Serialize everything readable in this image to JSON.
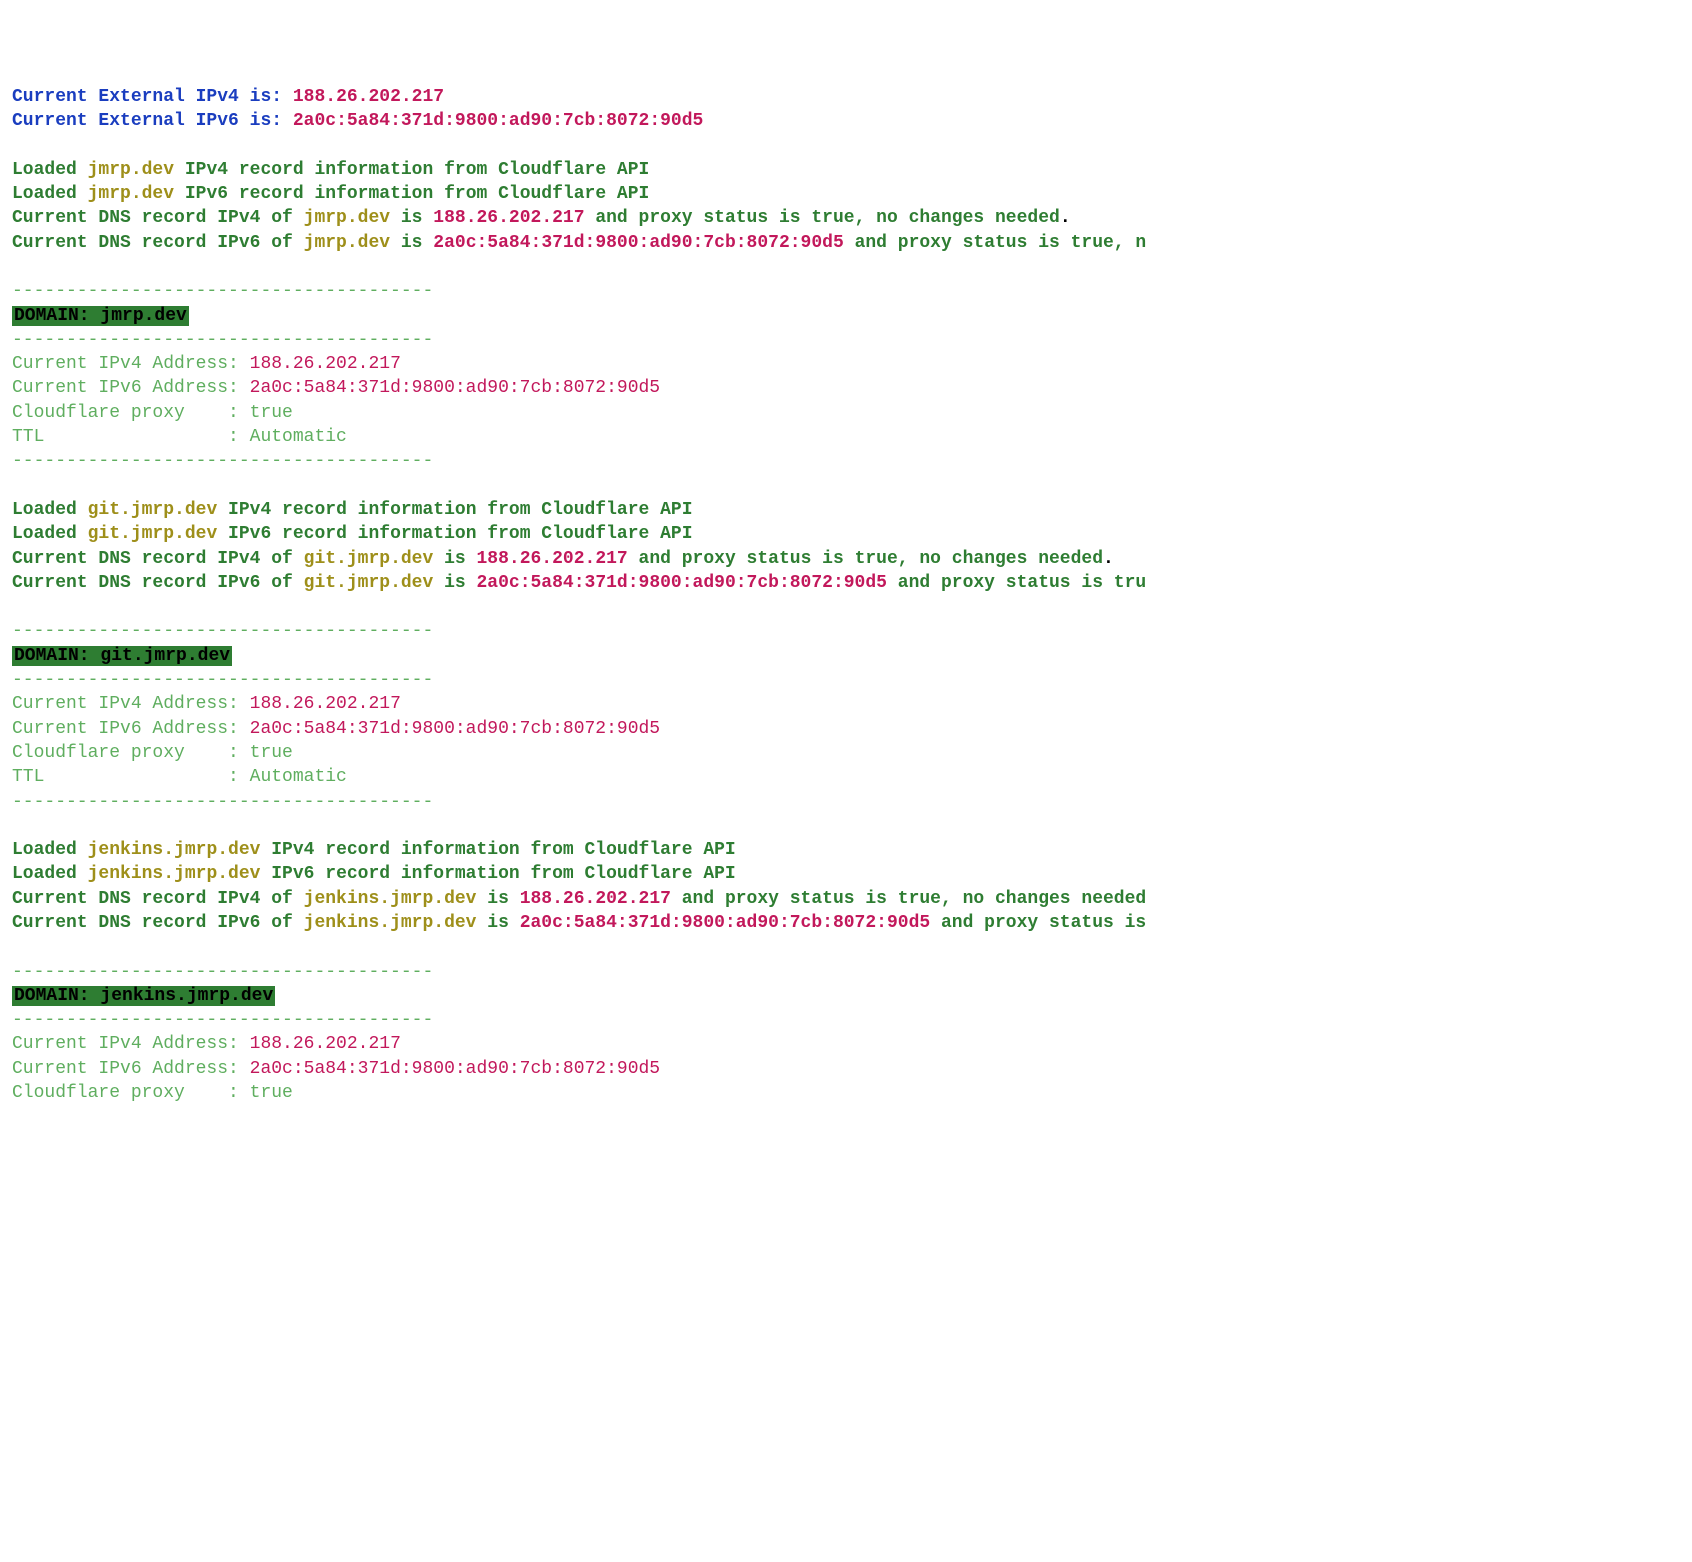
{
  "labels": {
    "ext_ipv4": "Current External IPv4 is: ",
    "ext_ipv6": "Current External IPv6 is: ",
    "loaded": "Loaded ",
    "ipv4_rec": " IPv4 record information from Cloudflare API",
    "ipv6_rec": " IPv6 record information from Cloudflare API",
    "cur_dns_ipv4": "Current DNS record IPv4 of ",
    "cur_dns_ipv6": "Current DNS record IPv6 of ",
    "is": " is ",
    "proxy_tail": " and proxy status is true, no changes needed",
    "proxy_tail_trunc1": " and proxy status is true, n",
    "proxy_tail_trunc2": " and proxy status is tru",
    "proxy_tail_trunc3": " and proxy status is true, no changes needed",
    "proxy_tail_trunc4": " and proxy status is",
    "sep": "---------------------------------------",
    "domain_hdr": "DOMAIN: ",
    "cur_ipv4_addr": "Current IPv4 Address: ",
    "cur_ipv6_addr": "Current IPv6 Address: ",
    "cf_proxy": "Cloudflare proxy    : ",
    "ttl": "TTL                 : ",
    "dot": "."
  },
  "values": {
    "ipv4": "188.26.202.217",
    "ipv6": "2a0c:5a84:371d:9800:ad90:7cb:8072:90d5",
    "proxy": "true",
    "ttl": "Automatic"
  },
  "domains": {
    "d1": "jmrp.dev",
    "d2": "git.jmrp.dev",
    "d3": "jenkins.jmrp.dev"
  }
}
